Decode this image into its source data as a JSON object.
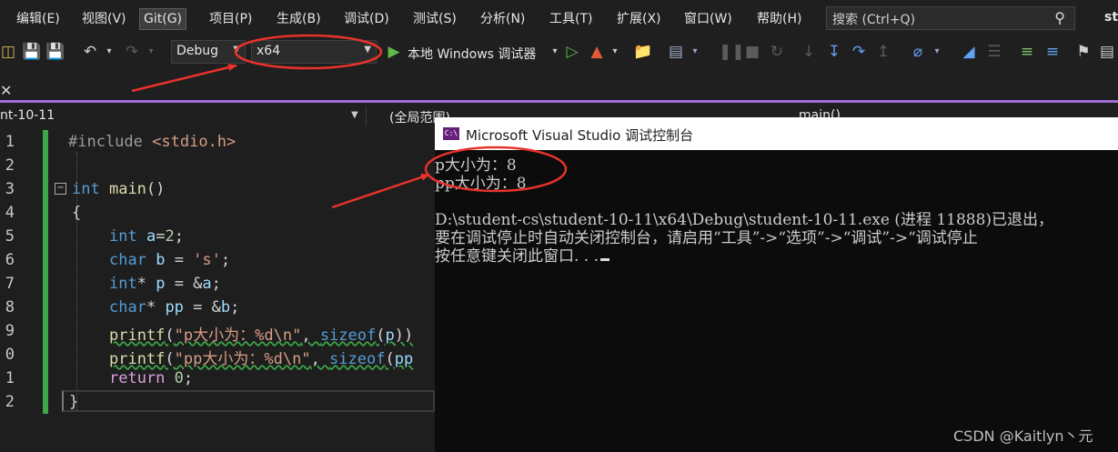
{
  "menu": {
    "items": [
      "编辑(E)",
      "视图(V)",
      "Git(G)",
      "项目(P)",
      "生成(B)",
      "调试(D)",
      "测试(S)",
      "分析(N)",
      "工具(T)",
      "扩展(X)",
      "窗口(W)",
      "帮助(H)"
    ],
    "search_placeholder": "搜索 (Ctrl+Q)",
    "window_title": "st"
  },
  "toolbar": {
    "configuration": "Debug",
    "platform": "x64",
    "run_label": "本地 Windows 调试器"
  },
  "nav": {
    "project": "nt-10-11",
    "scope": "(全局范围)",
    "function": "main()"
  },
  "editor": {
    "line_numbers": [
      "1",
      "2",
      "3",
      "4",
      "5",
      "6",
      "7",
      "8",
      "9",
      "0",
      "1",
      "2"
    ]
  },
  "console": {
    "title": "Microsoft Visual Studio 调试控制台",
    "icon_label": "C:\\",
    "lines": [
      "p大小为：8",
      "pp大小为：8",
      "",
      "D:\\student-cs\\student-10-11\\x64\\Debug\\student-10-11.exe (进程 11888)已退出，",
      "要在调试停止时自动关闭控制台，请启用“工具”->“选项”->“调试”->“调试停止",
      "按任意键关闭此窗口. . ."
    ]
  },
  "watermark": "CSDN @Kaitlyn丶元",
  "colors": {
    "annotation": "#e8322c",
    "change_bar": "#3da84a",
    "accent": "#9f6dd8"
  }
}
